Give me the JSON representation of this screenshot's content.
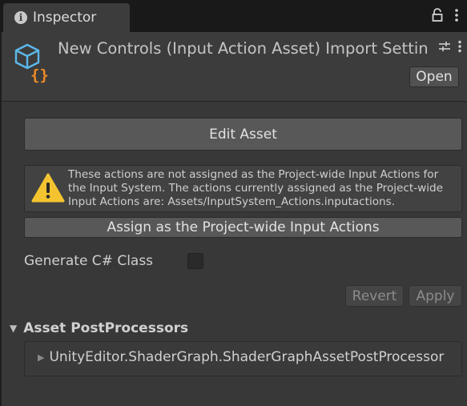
{
  "tab": {
    "title": "Inspector",
    "icon": "info-icon"
  },
  "tab_actions": {
    "lock_icon": "lock-icon",
    "menu_icon": "kebab-menu-icon"
  },
  "header": {
    "title": "New Controls (Input Action Asset) Import Settings",
    "asset_icon": "input-action-asset-icon",
    "settings_icon": "preset-sliders-icon",
    "menu_icon": "kebab-menu-icon",
    "open_label": "Open"
  },
  "edit_asset_label": "Edit Asset",
  "warning": {
    "icon": "warning-icon",
    "text": "These actions are not assigned as the Project-wide Input Actions for the Input System.  The actions currently assigned as the Project-wide Input Actions are: Assets/InputSystem_Actions.inputactions."
  },
  "assign_label": "Assign as the Project-wide Input Actions",
  "generate_csharp": {
    "label": "Generate C# Class",
    "checked": false
  },
  "revert_label": "Revert",
  "apply_label": "Apply",
  "post_processors": {
    "title": "Asset PostProcessors",
    "items": [
      "UnityEditor.ShaderGraph.ShaderGraphAssetPostProcessor"
    ]
  },
  "colors": {
    "background": "#383838",
    "button": "#585858",
    "warning": "#f4c430",
    "icon_blue": "#5bb8e8",
    "icon_orange": "#f08a24"
  }
}
